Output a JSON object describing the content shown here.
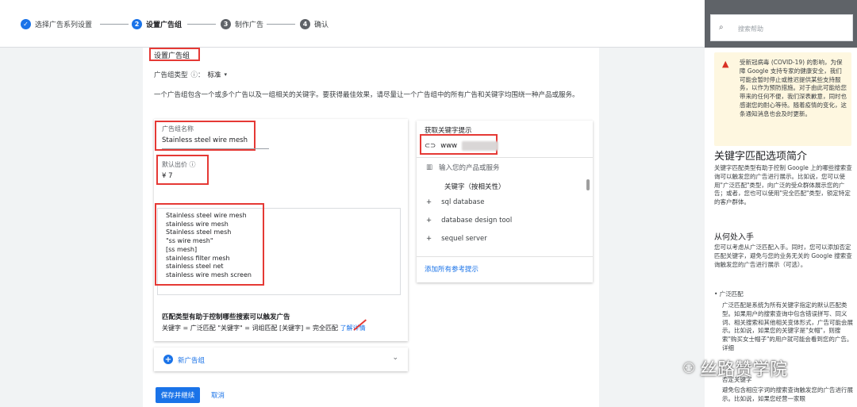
{
  "stepper": {
    "steps": [
      {
        "num": "✓",
        "label": "选择广告系列设置"
      },
      {
        "num": "2",
        "label": "设置广告组"
      },
      {
        "num": "3",
        "label": "制作广告"
      },
      {
        "num": "4",
        "label": "确认"
      }
    ]
  },
  "main": {
    "title": "设置广告组",
    "type_label": "广告组类型",
    "type_value": "标准",
    "description": "一个广告组包含一个或多个广告以及一组相关的关键字。要获得最佳效果，请尽量让一个广告组中的所有广告和关键字均围绕一种产品或服务。",
    "name_label": "广告组名称",
    "name_value": "Stainless steel wire mesh",
    "bid_label": "默认出价",
    "bid_value": "¥ 7",
    "keywords": [
      "Stainless steel wire mesh",
      "stainless wire mesh",
      "Stainless steel mesh",
      "\"ss wire mesh\"",
      "[ss mesh]",
      "stainless filter mesh",
      "stainless steel net",
      "stainless wire mesh screen"
    ],
    "match_heading": "匹配类型有助于控制哪些搜索可以触发广告",
    "match_text": "关键字 = 广泛匹配 \"关键字\" = 词组匹配 [关键字] = 完全匹配",
    "match_link": "了解详情",
    "new_group": "新广告组",
    "save_button": "保存并继续",
    "cancel_button": "取消"
  },
  "suggestions": {
    "heading": "获取关键字提示",
    "url_prefix": "www",
    "product_placeholder": "输入您的产品或服务",
    "sort_label": "关键字（按相关性）",
    "items": [
      "sql database",
      "database design tool",
      "sequel server"
    ],
    "add_all": "添加所有参考提示"
  },
  "help": {
    "search_placeholder": "搜索帮助",
    "alert": "受新冠病毒 (COVID-19) 的影响，为保障 Google 支持专家的健康安全，我们可能会暂时停止或推迟提供某些支持服务，以作为预防措施。对于由此可能给您带来的任何不便，我们深表歉意，同时也感谢您的耐心等待。随着疫情的变化，这条通知消息也会及时更新。",
    "title": "关键字匹配选项简介",
    "intro": "关键字匹配类型有助于控制 Google 上的哪些搜索查询可以触发您的广告进行展示。比如说，您可以使用\"广泛匹配\"类型，向广泛的受众群体展示您的广告；或者，您也可以使用\"完全匹配\"类型，锁定特定的客户群体。",
    "sub1": "从何处入手",
    "para1": "您可以考虑从广泛匹配入手。同时，您可以添加否定匹配关键字，避免与您的业务无关的 Google 搜索查询触发您的广告进行展示（可选）。",
    "bullet": "• 广泛匹配",
    "para2": "广泛匹配是系统为所有关键字指定的默认匹配类型。如果用户的搜索查询中包含错误拼写、同义词、相关搜索和其他相关变体形式，广告可能会展示。比如说，如果您的关键字是\"女帽\"，则搜索\"购买女士帽子\"的用户就可能会看到您的广告。详细",
    "more": "否定关键字",
    "para3": "避免包含相应字词的搜索查询触发您的广告进行展示。比如说，如果您经营一家眼"
  },
  "watermark": "丝路赞学院"
}
